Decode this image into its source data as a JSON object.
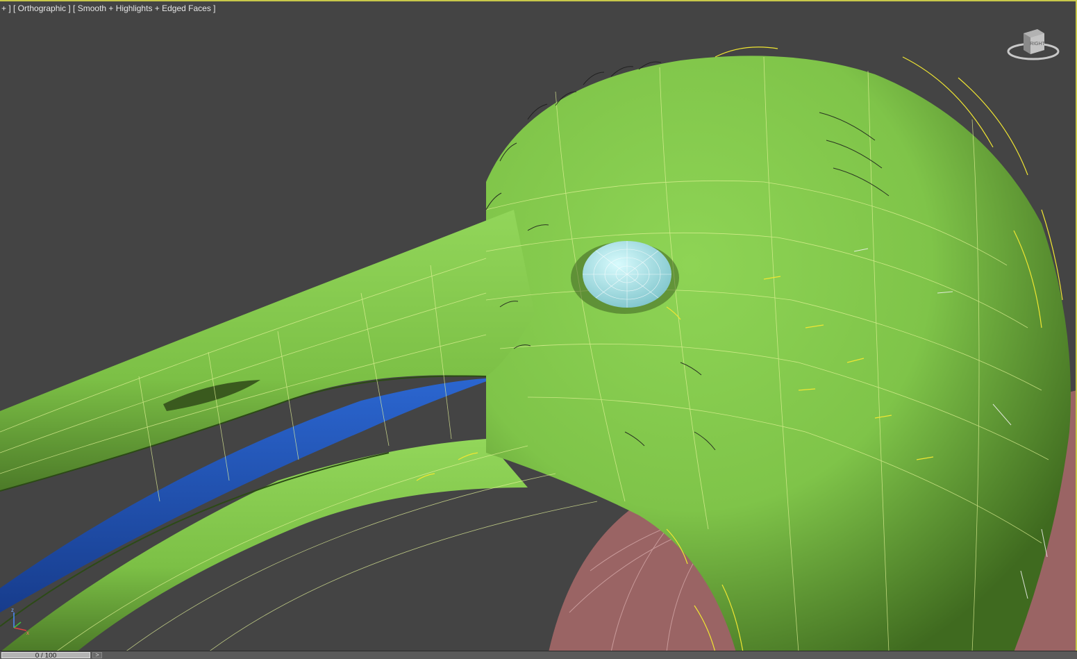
{
  "viewport": {
    "label": "+ ] [ Orthographic ] [ Smooth + Highlights + Edged Faces ]",
    "viewcube_face": "RIGHT",
    "axis": {
      "z": "z",
      "x": "x"
    }
  },
  "timeline": {
    "frame_display": "0 / 100",
    "next_label": ">"
  },
  "colors": {
    "viewport_bg": "#444444",
    "active_border": "#c8c84a",
    "head_green": "#82c84a",
    "tongue_blue": "#1e50b4",
    "eye_cyan": "#a8e6ea",
    "body_pink": "#9a6464",
    "hair_yellow": "#f0e632"
  },
  "icons": [
    "viewcube-icon",
    "axis-tripod-icon"
  ]
}
